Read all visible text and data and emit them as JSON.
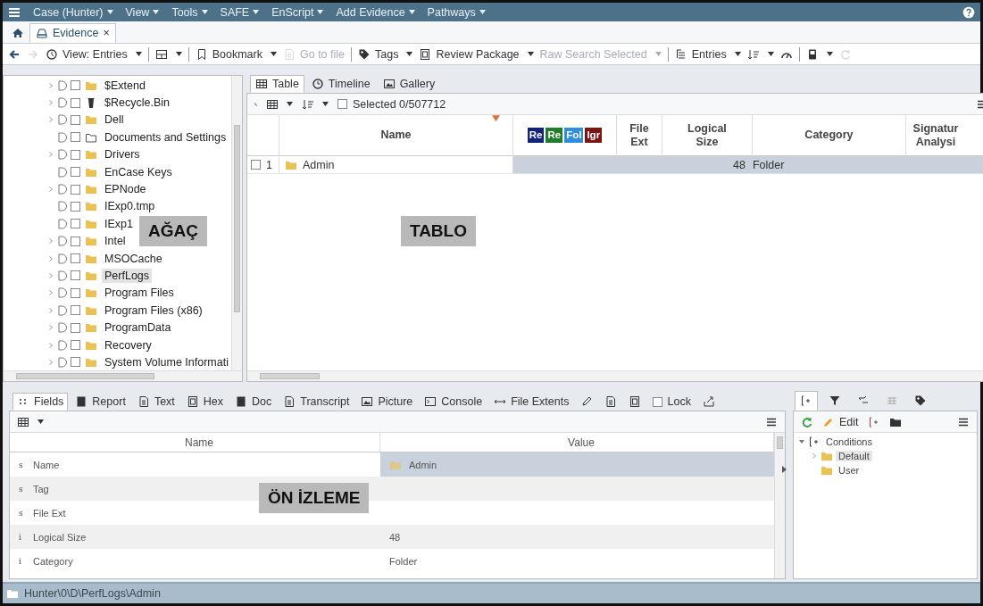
{
  "menu_bar": {
    "items": [
      {
        "label": "Case (Hunter)"
      },
      {
        "label": "View"
      },
      {
        "label": "Tools"
      },
      {
        "label": "SAFE"
      },
      {
        "label": "EnScript"
      },
      {
        "label": "Add Evidence"
      },
      {
        "label": "Pathways"
      }
    ]
  },
  "tabs": [
    {
      "label": "Evidence",
      "selected": true,
      "close": "×"
    }
  ],
  "toolbar": [
    {
      "kind": "button",
      "disabled": false,
      "dropdown": false
    },
    {
      "kind": "button",
      "disabled": true,
      "dropdown": false
    },
    {
      "kind": "button",
      "label": "View: Entries",
      "disabled": false,
      "dropdown": true
    },
    {
      "kind": "separator"
    },
    {
      "kind": "button",
      "disabled": false,
      "dropdown": true
    },
    {
      "kind": "separator"
    },
    {
      "kind": "button",
      "label": "Bookmark",
      "disabled": false,
      "dropdown": true
    },
    {
      "kind": "button",
      "label": "Go to file",
      "disabled": true,
      "dropdown": false
    },
    {
      "kind": "separator"
    },
    {
      "kind": "button",
      "label": "Tags",
      "disabled": false,
      "dropdown": true
    },
    {
      "kind": "button",
      "label": "Review Package",
      "disabled": false,
      "dropdown": true
    },
    {
      "kind": "button",
      "label": "Raw Search Selected",
      "disabled": true,
      "dropdown": true
    },
    {
      "kind": "separator"
    },
    {
      "kind": "button",
      "label": "Entries",
      "disabled": false,
      "dropdown": true
    },
    {
      "kind": "button",
      "disabled": false,
      "dropdown": true
    },
    {
      "kind": "button",
      "disabled": false,
      "dropdown": false
    },
    {
      "kind": "separator"
    },
    {
      "kind": "button",
      "disabled": false,
      "dropdown": true
    },
    {
      "kind": "button",
      "disabled": true,
      "dropdown": false
    }
  ],
  "tree": {
    "items": [
      {
        "label": "$Extend",
        "kind": "folder",
        "expandable": true,
        "selected": false,
        "checked": false
      },
      {
        "label": "$Recycle.Bin",
        "kind": "bin",
        "expandable": true,
        "selected": false,
        "checked": false
      },
      {
        "label": "Dell",
        "kind": "folder",
        "expandable": true,
        "selected": false,
        "checked": false
      },
      {
        "label": "Documents and Settings",
        "kind": "link",
        "expandable": false,
        "selected": false,
        "checked": false
      },
      {
        "label": "Drivers",
        "kind": "folder",
        "expandable": true,
        "selected": false,
        "checked": false
      },
      {
        "label": "EnCase Keys",
        "kind": "folder",
        "expandable": false,
        "selected": false,
        "checked": false
      },
      {
        "label": "EPNode",
        "kind": "folder",
        "expandable": true,
        "selected": false,
        "checked": false
      },
      {
        "label": "IExp0.tmp",
        "kind": "folder",
        "expandable": false,
        "selected": false,
        "checked": false
      },
      {
        "label": "IExp1",
        "kind": "folder",
        "expandable": false,
        "selected": false,
        "checked": false
      },
      {
        "label": "Intel",
        "kind": "folder",
        "expandable": true,
        "selected": false,
        "checked": false
      },
      {
        "label": "MSOCache",
        "kind": "folder",
        "expandable": true,
        "selected": false,
        "checked": false
      },
      {
        "label": "PerfLogs",
        "kind": "folder",
        "expandable": true,
        "selected": true,
        "checked": false
      },
      {
        "label": "Program Files",
        "kind": "folder",
        "expandable": true,
        "selected": false,
        "checked": false
      },
      {
        "label": "Program Files (x86)",
        "kind": "folder",
        "expandable": true,
        "selected": false,
        "checked": false
      },
      {
        "label": "ProgramData",
        "kind": "folder",
        "expandable": true,
        "selected": false,
        "checked": false
      },
      {
        "label": "Recovery",
        "kind": "folder",
        "expandable": true,
        "selected": false,
        "checked": false
      },
      {
        "label": "System Volume Informati",
        "kind": "folder",
        "expandable": true,
        "selected": false,
        "checked": false
      }
    ]
  },
  "view_tabs": [
    {
      "label": "Table",
      "selected": true
    },
    {
      "label": "Timeline",
      "selected": false
    },
    {
      "label": "Gallery",
      "selected": false
    }
  ],
  "tree_annotation": "AĞAÇ",
  "table_annotation": "TABLO",
  "preview_annotation": "ÖN İZLEME",
  "table": {
    "selection": "Selected 0/507712",
    "select_all_checked": false,
    "columns": [
      {
        "label": "Name",
        "sorted": true
      },
      {
        "kind": "tags",
        "tags": [
          {
            "label": "Re",
            "color": "#14237a"
          },
          {
            "label": "Re",
            "color": "#1f7d2c"
          },
          {
            "label": "Fol",
            "color": "#2f8ee0"
          },
          {
            "label": "Igr",
            "color": "#7d1414"
          }
        ]
      },
      {
        "label": "File Ext",
        "sorted": false
      },
      {
        "label": "Logical Size",
        "sorted": false
      },
      {
        "label": "Category",
        "sorted": false
      },
      {
        "label": "Signatur Analysi",
        "sorted": false
      }
    ],
    "rows": [
      {
        "number": "1",
        "checked": false,
        "selected": true,
        "name": "Admin",
        "logical_size": "48",
        "category": "Folder"
      }
    ]
  },
  "preview_tabs": [
    {
      "label": "Fields",
      "selected": true
    },
    {
      "label": "Report",
      "selected": false
    },
    {
      "label": "Text",
      "selected": false
    },
    {
      "label": "Hex",
      "selected": false
    },
    {
      "label": "Doc",
      "selected": false
    },
    {
      "label": "Transcript",
      "selected": false
    },
    {
      "label": "Picture",
      "selected": false
    },
    {
      "label": "Console",
      "selected": false
    },
    {
      "label": "File Extents",
      "selected": false
    },
    {
      "selected": false
    },
    {
      "selected": false
    },
    {
      "selected": false
    },
    {
      "label": "Lock",
      "kind": "checkbox",
      "checked": false
    },
    {
      "selected": false
    }
  ],
  "fields": {
    "columns": [
      {
        "label": "Name"
      },
      {
        "label": "Value"
      }
    ],
    "rows": [
      {
        "type": "s",
        "name": "Name",
        "value": "Admin",
        "folder": true,
        "selected": true
      },
      {
        "type": "s",
        "name": "Tag",
        "selected": false
      },
      {
        "type": "s",
        "name": "File Ext",
        "selected": false
      },
      {
        "type": "i",
        "name": "Logical Size",
        "value": "48",
        "selected": false
      },
      {
        "type": "i",
        "name": "Category",
        "value": "Folder",
        "selected": false
      }
    ]
  },
  "conditions_panel": {
    "edit": "Edit",
    "tree": [
      {
        "label": "Conditions",
        "expanded": true,
        "selected": false,
        "children": [
          {
            "label": "Default",
            "expandable": true,
            "selected": true
          },
          {
            "label": "User",
            "expandable": false,
            "selected": false
          }
        ]
      }
    ]
  },
  "status_bar": {
    "path": "Hunter\\0\\D\\PerfLogs\\Admin"
  }
}
